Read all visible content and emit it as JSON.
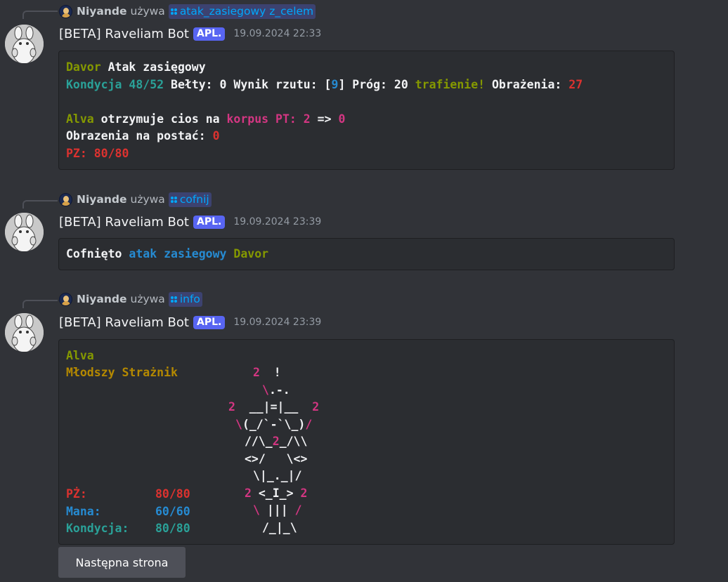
{
  "colors": {
    "background": "#313338",
    "codeblock": "#2b2d31",
    "app_tag": "#5865f2",
    "command_text": "#00a8fc",
    "button": "#4e5058"
  },
  "bot": {
    "name": "[BETA] Raveliam Bot",
    "tag": "APL."
  },
  "messages": [
    {
      "reply": {
        "user": "Niyande",
        "verb": "używa",
        "command": "atak_zasiegowy z_celem"
      },
      "timestamp": "19.09.2024 22:33",
      "lines": [
        [
          {
            "t": "Davor",
            "c": "green"
          },
          {
            "t": " Atak zasięgowy",
            "c": "white"
          }
        ],
        [
          {
            "t": "Kondycja ",
            "c": "cyan"
          },
          {
            "t": "48/52",
            "c": "cyan"
          },
          {
            "t": " Bełty: 0 Wynik rzutu: [",
            "c": "white"
          },
          {
            "t": "9",
            "c": "blue"
          },
          {
            "t": "] Próg: 20 ",
            "c": "white"
          },
          {
            "t": "trafienie!",
            "c": "green"
          },
          {
            "t": " Obrażenia: ",
            "c": "white"
          },
          {
            "t": "27",
            "c": "red"
          }
        ],
        [],
        [
          {
            "t": "Alva",
            "c": "green"
          },
          {
            "t": " otrzymuje cios na ",
            "c": "white"
          },
          {
            "t": "korpus",
            "c": "pink"
          },
          {
            "t": " ",
            "c": "white"
          },
          {
            "t": "PT:",
            "c": "pink"
          },
          {
            "t": " ",
            "c": "white"
          },
          {
            "t": "2",
            "c": "pink"
          },
          {
            "t": " => ",
            "c": "white"
          },
          {
            "t": "0",
            "c": "pink"
          }
        ],
        [
          {
            "t": "Obrazenia na postać: ",
            "c": "white"
          },
          {
            "t": "0",
            "c": "red"
          }
        ],
        [
          {
            "t": "PZ: 80/80",
            "c": "red"
          }
        ]
      ]
    },
    {
      "reply": {
        "user": "Niyande",
        "verb": "używa",
        "command": "cofnij"
      },
      "timestamp": "19.09.2024 23:39",
      "lines": [
        [
          {
            "t": "Cofnięto ",
            "c": "white"
          },
          {
            "t": "atak zasiegowy",
            "c": "blue"
          },
          {
            "t": " ",
            "c": "white"
          },
          {
            "t": "Davor",
            "c": "green"
          }
        ]
      ]
    },
    {
      "reply": {
        "user": "Niyande",
        "verb": "używa",
        "command": "info"
      },
      "timestamp": "19.09.2024 23:39",
      "character": {
        "name": "Alva",
        "rank": "Młodszy Strażnik",
        "stats": [
          {
            "label": "PŻ:",
            "value": "80/80",
            "c": "red"
          },
          {
            "label": "Mana:",
            "value": "60/60",
            "c": "blue"
          },
          {
            "label": "Kondycja:",
            "value": "80/80",
            "c": "cyan"
          }
        ]
      },
      "art_lines": [
        [
          {
            "t": "2",
            "c": "pink"
          },
          {
            "t": "  !",
            "c": "white"
          }
        ],
        [
          {
            "t": "\\",
            "c": "pink"
          },
          {
            "t": ".-.",
            "c": "white"
          }
        ],
        [
          {
            "t": "2",
            "c": "pink"
          },
          {
            "t": "  __|=|__  ",
            "c": "white"
          },
          {
            "t": "2",
            "c": "pink"
          }
        ],
        [
          {
            "t": "\\",
            "c": "pink"
          },
          {
            "t": "(_/`-`\\_)",
            "c": "white"
          },
          {
            "t": "/",
            "c": "pink"
          }
        ],
        [
          {
            "t": "//\\_",
            "c": "white"
          },
          {
            "t": "2",
            "c": "pink"
          },
          {
            "t": "_/\\\\",
            "c": "white"
          }
        ],
        [
          {
            "t": "<>/   \\<>",
            "c": "white"
          }
        ],
        [
          {
            "t": "\\|_._|/",
            "c": "white"
          }
        ],
        [
          {
            "t": "2",
            "c": "pink"
          },
          {
            "t": " <_I_> ",
            "c": "white"
          },
          {
            "t": "2",
            "c": "pink"
          }
        ],
        [
          {
            "t": "\\",
            "c": "pink"
          },
          {
            "t": " ||| ",
            "c": "white"
          },
          {
            "t": "/",
            "c": "pink"
          }
        ],
        [
          {
            "t": "/_|_\\",
            "c": "white"
          }
        ]
      ],
      "button": {
        "label": "Następna strona"
      }
    }
  ]
}
